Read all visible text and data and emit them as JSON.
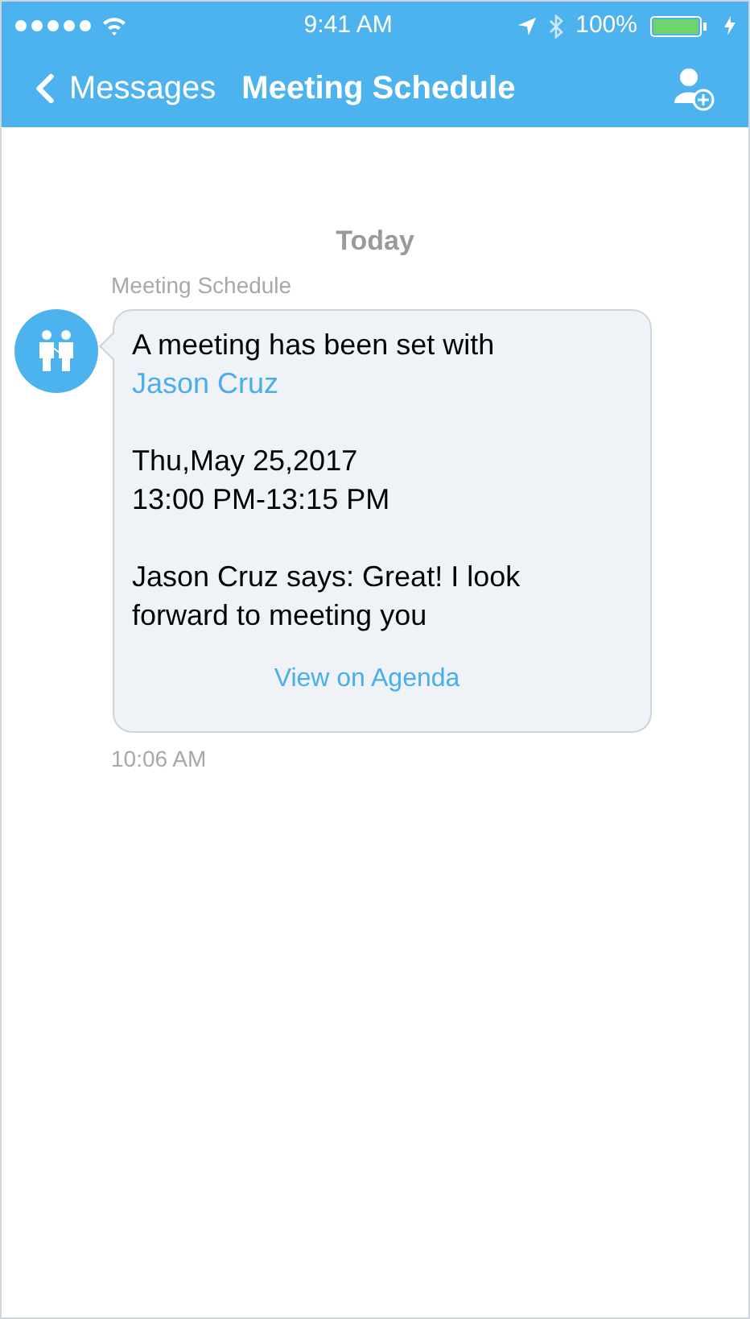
{
  "status_bar": {
    "time": "9:41 AM",
    "battery": "100%"
  },
  "nav": {
    "back_label": "Messages",
    "title": "Meeting Schedule"
  },
  "chat": {
    "date_separator": "Today",
    "messages": [
      {
        "sender": "Meeting Schedule",
        "intro": "A meeting has been set with",
        "contact_link": "Jason Cruz",
        "date": "Thu,May 25,2017",
        "time_range": "13:00 PM-13:15 PM",
        "reply": "Jason Cruz says: Great! I look forward to meeting you",
        "action_link": "View on Agenda",
        "timestamp": "10:06 AM"
      }
    ]
  }
}
